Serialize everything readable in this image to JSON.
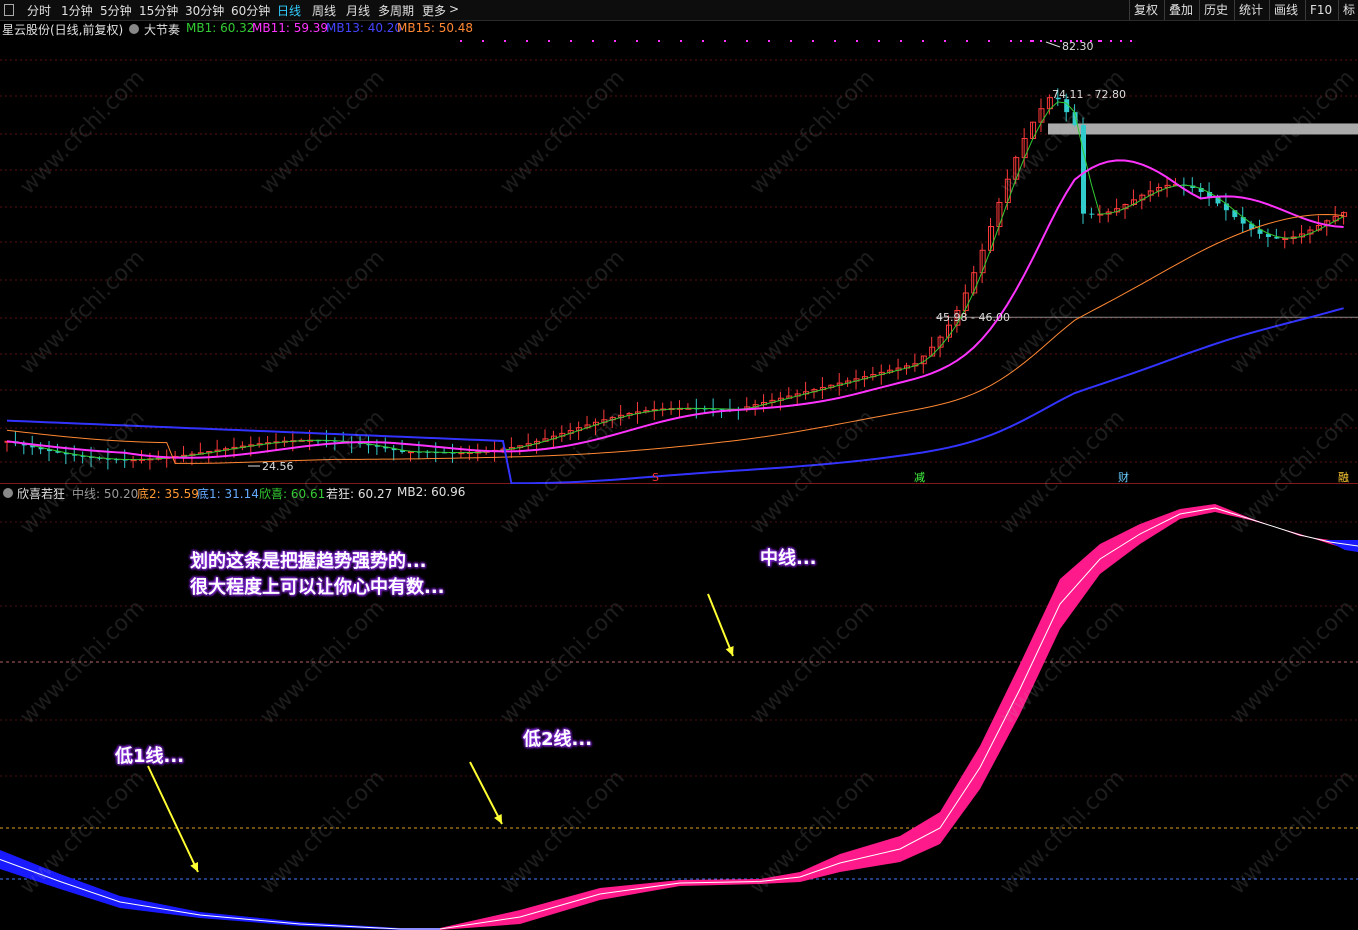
{
  "toolbar": {
    "tabs": [
      "分时",
      "1分钟",
      "5分钟",
      "15分钟",
      "30分钟",
      "60分钟",
      "日线",
      "周线",
      "月线",
      "多周期",
      "更多"
    ],
    "active_tab": "日线",
    "more_arrow": ">",
    "right_buttons": [
      "复权",
      "叠加",
      "历史",
      "统计",
      "画线",
      "F10",
      "标"
    ]
  },
  "main_panel": {
    "stock_title": "星云股份(日线,前复权)",
    "indicator_name": "大节奏",
    "mb1": "MB1: 60.32",
    "mb11": "MB11: 59.39",
    "mb13": "MB13: 40.20",
    "mb15": "MB15: 50.48",
    "high_label": "82.30",
    "low_label": "24.56",
    "zone_top_label": "74.11 - 72.80",
    "zone_bottom_label": "45.98 - 46.00",
    "marks": [
      {
        "text": "S",
        "color": "#ff3333"
      },
      {
        "text": "减",
        "color": "#44ff44"
      },
      {
        "text": "财",
        "color": "#66ccff"
      },
      {
        "text": "融",
        "color": "#ffcc33"
      }
    ]
  },
  "sub_panel": {
    "name": "欣喜若狂",
    "mid": "中线: 50.20",
    "di2": "底2: 35.59",
    "di1": "底1: 31.14",
    "xinxi": "欣喜: 60.61",
    "ruokuang": "若狂: 60.27",
    "mb2": "MB2: 60.96"
  },
  "annotations": {
    "line1": "划的这条是把握趋势强势的...",
    "line2": "很大程度上可以让你心中有数...",
    "mid_line": "中线...",
    "low2_line": "低2线...",
    "low1_line": "低1线..."
  },
  "watermark": "www.cfchi.com",
  "colors": {
    "up_candle": "#ff3a3a",
    "down_candle": "#33cccc",
    "mb1": "#33cc33",
    "mb11": "#ff33ff",
    "mb13": "#3333ff",
    "mb15": "#ff8833",
    "fill_up": "#ff1a8c",
    "fill_down": "#1a1aff"
  },
  "chart_data": {
    "type": "line",
    "title": "星云股份(日线,前复权)",
    "price_high": 82.3,
    "price_low": 24.56,
    "resistance_zone": [
      72.8,
      74.11
    ],
    "support_zone": [
      45.98,
      46.0
    ],
    "series": [
      {
        "name": "MB1",
        "last": 60.32
      },
      {
        "name": "MB11",
        "last": 59.39
      },
      {
        "name": "MB13",
        "last": 40.2
      },
      {
        "name": "MB15",
        "last": 50.48
      }
    ],
    "sub_series": [
      {
        "name": "中线",
        "last": 50.2
      },
      {
        "name": "底2",
        "last": 35.59
      },
      {
        "name": "底1",
        "last": 31.14
      },
      {
        "name": "欣喜",
        "last": 60.61
      },
      {
        "name": "若狂",
        "last": 60.27
      },
      {
        "name": "MB2",
        "last": 60.96
      }
    ]
  }
}
